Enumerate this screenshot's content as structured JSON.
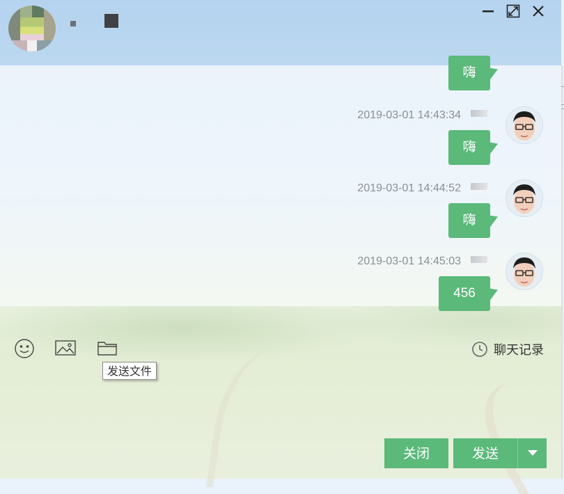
{
  "header": {
    "contact_avatar": "blurred-avatar",
    "window_controls": {
      "minimize_icon": "minimize-icon",
      "maximize_icon": "maximize-icon",
      "close_icon": "close-icon"
    }
  },
  "messages": [
    {
      "time": "",
      "text": "嗨"
    },
    {
      "time": "2019-03-01 14:43:34",
      "text": "嗨"
    },
    {
      "time": "2019-03-01 14:44:52",
      "text": "嗨"
    },
    {
      "time": "2019-03-01 14:45:03",
      "text": "456"
    }
  ],
  "toolbar": {
    "emoji_icon": "emoji-icon",
    "image_icon": "image-icon",
    "file_icon": "folder-icon",
    "tooltip": "发送文件",
    "history_label": "聊天记录",
    "history_icon": "clock-icon"
  },
  "input": {
    "value": ""
  },
  "footer": {
    "close_label": "关闭",
    "send_label": "发送",
    "send_options_icon": "caret-down-icon"
  },
  "colors": {
    "accent": "#5bb97a",
    "header": "#b5d3ef",
    "timestamp": "#8a8f95"
  }
}
